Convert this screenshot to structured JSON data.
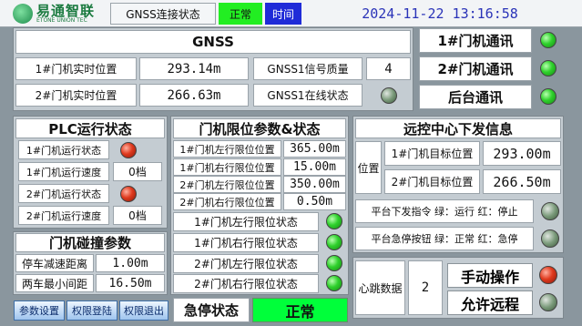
{
  "brand": {
    "name": "易通智联",
    "sub": "ETONE UNION TEC"
  },
  "topbar": {
    "gnss_title": "GNSS连接状态",
    "status": "正常",
    "time_label": "时间",
    "datetime": "2024-11-22 13:16:58"
  },
  "gnss": {
    "title": "GNSS",
    "gate1_label": "1#门机实时位置",
    "gate1_pos": "293.14m",
    "gate2_label": "2#门机实时位置",
    "gate2_pos": "266.63m",
    "signal_label": "GNSS1信号质量",
    "signal_value": "4",
    "online_label": "GNSS1在线状态"
  },
  "comm": {
    "gate1": "1#门机通讯",
    "gate2": "2#门机通讯",
    "backend": "后台通讯"
  },
  "plc": {
    "title": "PLC运行状态",
    "rows": [
      {
        "label": "1#门机运行状态"
      },
      {
        "label": "1#门机运行速度",
        "value": "0档"
      },
      {
        "label": "2#门机运行状态"
      },
      {
        "label": "2#门机运行速度",
        "value": "0档"
      }
    ]
  },
  "limit": {
    "title": "门机限位参数&状态",
    "params": [
      {
        "label": "1#门机左行限位位置",
        "value": "365.00m"
      },
      {
        "label": "1#门机右行限位位置",
        "value": "15.00m"
      },
      {
        "label": "2#门机左行限位位置",
        "value": "350.00m"
      },
      {
        "label": "2#门机右行限位位置",
        "value": "0.50m"
      }
    ],
    "states": [
      {
        "label": "1#门机左行限位状态"
      },
      {
        "label": "1#门机右行限位状态"
      },
      {
        "label": "2#门机左行限位状态"
      },
      {
        "label": "2#门机右行限位状态"
      }
    ]
  },
  "collision": {
    "title": "门机碰撞参数",
    "stop_label": "停车减速距离",
    "stop_value": "1.00m",
    "min_label": "两车最小间距",
    "min_value": "16.50m"
  },
  "remote": {
    "title": "远控中心下发信息",
    "pos_label": "位置",
    "gate1_label": "1#门机目标位置",
    "gate1_value": "293.00m",
    "gate2_label": "2#门机目标位置",
    "gate2_value": "266.50m",
    "cmd_label": "平台下发指令 绿：运行 红：停止",
    "estop_label": "平台急停按钮 绿：正常 红：急停"
  },
  "heartbeat": {
    "label": "心跳数据",
    "value": "2"
  },
  "manual": {
    "label": "手动操作"
  },
  "allow": {
    "label": "允许远程"
  },
  "bottom": {
    "btn_params": "参数设置",
    "btn_login": "权限登陆",
    "btn_logout": "权限退出",
    "estop_label": "急停状态",
    "estop_status": "正常"
  },
  "colors": {
    "green": "#22ee22",
    "blue": "#1f2bd8",
    "status_green": "#00ff3a"
  }
}
